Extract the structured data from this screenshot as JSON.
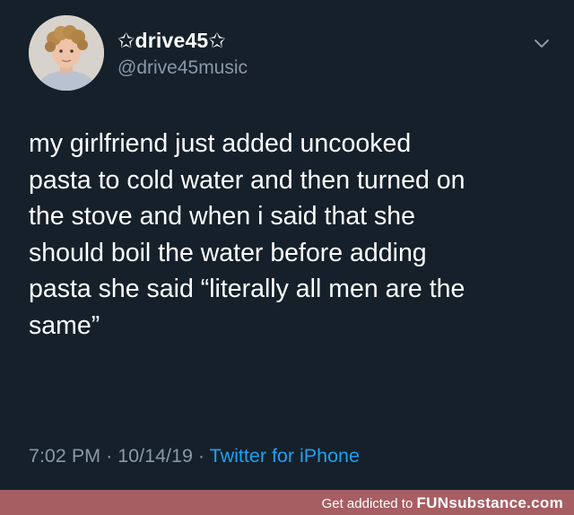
{
  "tweet": {
    "display_name": "✩drive45✩",
    "handle": "@drive45music",
    "text_lines": [
      "my girlfriend just added uncooked",
      "pasta to cold water and then turned on",
      "the stove and when i said that she",
      "should boil the water before adding",
      "pasta she said “literally all men are the",
      "same”"
    ],
    "time": "7:02 PM",
    "separator": "·",
    "date": "10/14/19",
    "source": "Twitter for iPhone"
  },
  "footer": {
    "tagline": "Get addicted to",
    "brand": "FUNsubstance.com"
  },
  "colors": {
    "background": "#15202b",
    "secondary_text": "#8899a6",
    "link": "#1da1f2",
    "footer_bar": "#a65e63"
  }
}
